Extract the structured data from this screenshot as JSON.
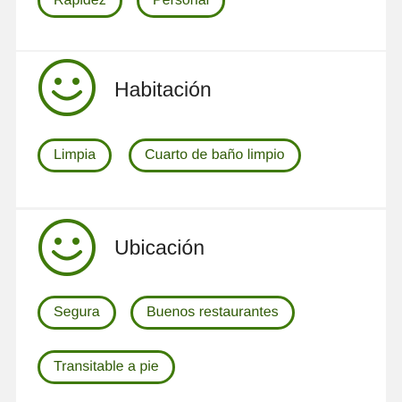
{
  "colors": {
    "accent": "#3f7a0a",
    "chip_text": "#2f5a06",
    "background": "#f2f2f2",
    "card": "#ffffff",
    "title_text": "#222222"
  },
  "previous_section": {
    "tags": [
      "Rapidez",
      "Personal"
    ]
  },
  "room_section": {
    "icon": "smiley-face-icon",
    "title": "Habitación",
    "tags": [
      "Limpia",
      "Cuarto de baño limpio"
    ]
  },
  "location_section": {
    "icon": "smiley-face-icon",
    "title": "Ubicación",
    "tags": [
      "Segura",
      "Buenos restaurantes",
      "Transitable a pie"
    ]
  }
}
